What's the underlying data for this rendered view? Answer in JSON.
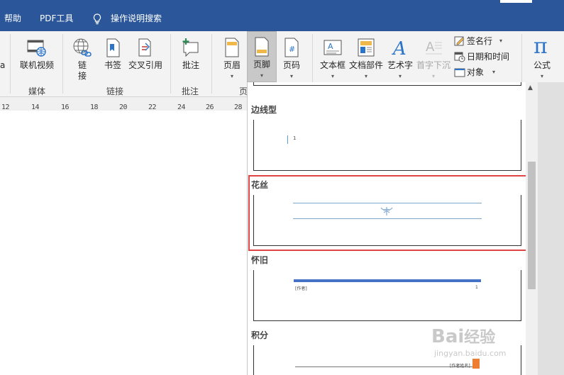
{
  "menubar": {
    "items": [
      "帮助",
      "PDF工具",
      "操作说明搜索"
    ]
  },
  "ribbon": {
    "partial_label": "a",
    "buttons": {
      "online_video": "联机视频",
      "link": "链\n接",
      "bookmark": "书签",
      "cross_ref": "交叉引用",
      "comment": "批注",
      "header": "页眉",
      "footer": "页脚",
      "page_number": "页码",
      "text_box": "文本框",
      "quick_parts": "文档部件",
      "wordart": "艺术字",
      "drop_cap": "首字下沉",
      "equation": "公式"
    },
    "small_buttons": {
      "signature": "签名行",
      "date_time": "日期和时间",
      "object": "对象"
    },
    "groups": {
      "media": "媒体",
      "links": "链接",
      "comments": "批注",
      "header_footer_partial": "页"
    }
  },
  "ruler": {
    "ticks": [
      "12",
      "14",
      "16",
      "18",
      "20",
      "22",
      "24",
      "26",
      "28"
    ]
  },
  "gallery": {
    "sections": [
      "边线型",
      "花丝",
      "怀旧",
      "积分"
    ],
    "previews": {
      "sideline_page": "1",
      "retro_author": "[作者]",
      "retro_page": "1",
      "integral_author": "[作者姓名]"
    }
  },
  "watermark": {
    "main": "Bai",
    "sub": "jingyan.baidu.com",
    "cn": "经验"
  },
  "colors": {
    "accent": "#2b579a",
    "highlight": "#e04545",
    "retro_bar": "#4472c4",
    "orange": "#ed7d31"
  }
}
